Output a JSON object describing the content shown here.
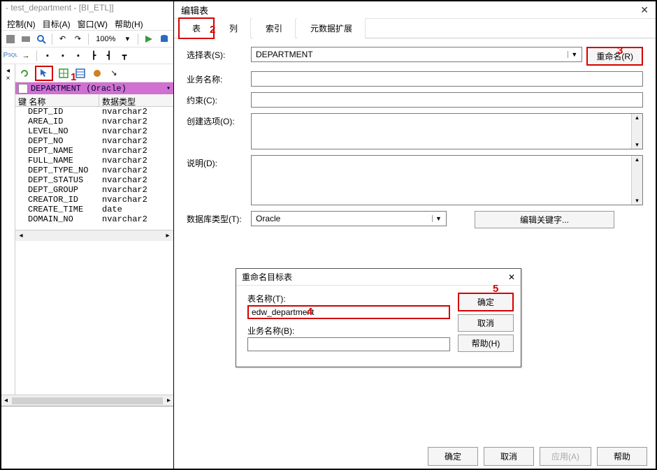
{
  "window": {
    "title": "- test_department - [BI_ETL]]"
  },
  "menu": {
    "control": "控制(N)",
    "target": "目标(A)",
    "window": "窗口(W)",
    "help": "帮助(H)"
  },
  "toolbar": {
    "zoom": "100%"
  },
  "tree": {
    "title": "DEPARTMENT (Oracle)",
    "col_key": "键",
    "col_name": "名称",
    "col_type": "数据类型",
    "rows": [
      {
        "name": "DEPT_ID",
        "type": "nvarchar2"
      },
      {
        "name": "AREA_ID",
        "type": "nvarchar2"
      },
      {
        "name": "LEVEL_NO",
        "type": "nvarchar2"
      },
      {
        "name": "DEPT_NO",
        "type": "nvarchar2"
      },
      {
        "name": "DEPT_NAME",
        "type": "nvarchar2"
      },
      {
        "name": "FULL_NAME",
        "type": "nvarchar2"
      },
      {
        "name": "DEPT_TYPE_NO",
        "type": "nvarchar2"
      },
      {
        "name": "DEPT_STATUS",
        "type": "nvarchar2"
      },
      {
        "name": "DEPT_GROUP",
        "type": "nvarchar2"
      },
      {
        "name": "CREATOR_ID",
        "type": "nvarchar2"
      },
      {
        "name": "CREATE_TIME",
        "type": "date"
      },
      {
        "name": "DOMAIN_NO",
        "type": "nvarchar2"
      }
    ]
  },
  "dialog": {
    "title": "编辑表",
    "tabs": {
      "table": "表",
      "column": "列",
      "index": "索引",
      "meta": "元数据扩展"
    },
    "labels": {
      "select_table": "选择表(S):",
      "biz_name": "业务名称:",
      "constraint": "约束(C):",
      "create_opt": "创建选项(O):",
      "desc": "说明(D):",
      "db_type": "数据库类型(T):"
    },
    "values": {
      "select_table": "DEPARTMENT",
      "db_type": "Oracle"
    },
    "buttons": {
      "rename": "重命名(R)",
      "edit_kw": "编辑关键字...",
      "ok": "确定",
      "cancel": "取消",
      "apply": "应用(A)",
      "help": "帮助"
    }
  },
  "modal": {
    "title": "重命名目标表",
    "table_name_label": "表名称(T):",
    "table_name_value": "edw_department",
    "biz_name_label": "业务名称(B):",
    "buttons": {
      "ok": "确定",
      "cancel": "取消",
      "help": "帮助(H)"
    }
  },
  "anno": {
    "n1": "1",
    "n2": "2",
    "n3": "3",
    "n4": "4",
    "n5": "5"
  }
}
